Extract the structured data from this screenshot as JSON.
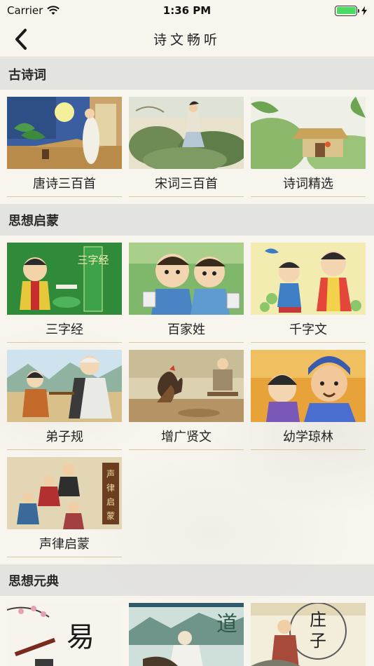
{
  "status_bar": {
    "carrier": "Carrier",
    "time": "1:36 PM"
  },
  "nav": {
    "title": "诗文畅听"
  },
  "sections": [
    {
      "title": "古诗词",
      "items": [
        "唐诗三百首",
        "宋词三百首",
        "诗词精选"
      ]
    },
    {
      "title": "思想启蒙",
      "items": [
        "三字经",
        "百家姓",
        "千字文",
        "弟子规",
        "增广贤文",
        "幼学琼林",
        "声律启蒙"
      ]
    },
    {
      "title": "思想元典"
    }
  ],
  "thumb_text": {
    "sanzijing": "三字经",
    "shenglv": [
      "声",
      "律",
      "启",
      "蒙"
    ],
    "yi": "易",
    "dao": "道",
    "zhuang": "庄",
    "zi": "子"
  }
}
